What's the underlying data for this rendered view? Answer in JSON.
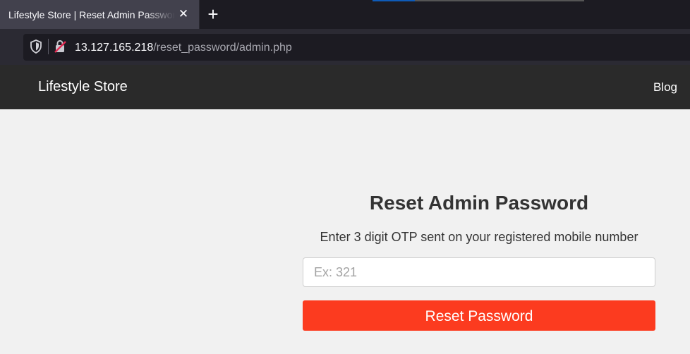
{
  "browser": {
    "tab_title": "Lifestyle Store | Reset Admin Password",
    "tab_close_glyph": "✕",
    "new_tab_glyph": "+",
    "url_host": "13.127.165.218",
    "url_path": "/reset_password/admin.php",
    "icons": [
      "shield-icon",
      "insecure-lock-icon"
    ]
  },
  "site": {
    "brand": "Lifestyle Store",
    "nav": {
      "blog": "Blog"
    }
  },
  "reset": {
    "title": "Reset Admin Password",
    "description": "Enter 3 digit OTP sent on your registered mobile number",
    "otp_placeholder": "Ex: 321",
    "otp_value": "",
    "button_label": "Reset Password"
  },
  "colors": {
    "header_bg": "#2a2a2a",
    "page_bg": "#f1f1f1",
    "button_bg": "#fc3b1f",
    "insecure_lock": "#e22850"
  }
}
